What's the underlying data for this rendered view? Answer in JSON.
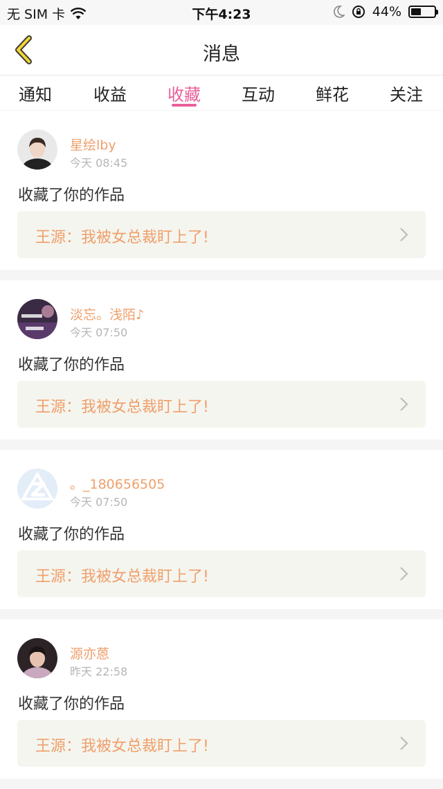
{
  "status_bar": {
    "carrier": "无 SIM 卡",
    "time": "下午4:23",
    "battery_percent_text": "44%",
    "battery_level": 0.44
  },
  "nav": {
    "title": "消息"
  },
  "tabs": [
    {
      "label": "通知",
      "active": false
    },
    {
      "label": "收益",
      "active": false
    },
    {
      "label": "收藏",
      "active": true
    },
    {
      "label": "互动",
      "active": false
    },
    {
      "label": "鲜花",
      "active": false
    },
    {
      "label": "关注",
      "active": false
    }
  ],
  "colors": {
    "accent": "#e9609a",
    "name": "#ef9f6b",
    "work_bg": "#f5f5ef"
  },
  "items": [
    {
      "user": "星绘lby",
      "time": "今天 08:45",
      "action": "收藏了你的作品",
      "work": "王源：我被女总裁盯上了!"
    },
    {
      "user": "淡忘。浅陌♪",
      "time": "今天 07:50",
      "action": "收藏了你的作品",
      "work": "王源：我被女总裁盯上了!"
    },
    {
      "user": "。_180656505",
      "time": "今天 07:50",
      "action": "收藏了你的作品",
      "work": "王源：我被女总裁盯上了!"
    },
    {
      "user": "源亦蒽",
      "time": "昨天 22:58",
      "action": "收藏了你的作品",
      "work": "王源：我被女总裁盯上了!"
    }
  ]
}
